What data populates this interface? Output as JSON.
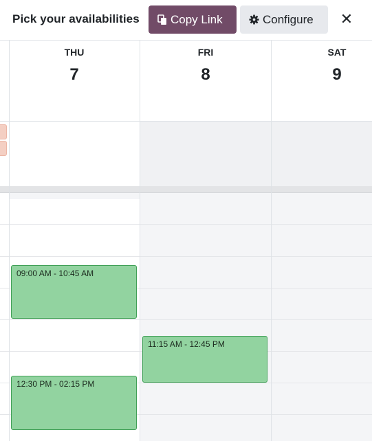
{
  "header": {
    "title": "Pick your availabilities",
    "copy_link_label": "Copy Link",
    "configure_label": "Configure",
    "close_glyph": "✕",
    "primary_color": "#714b67"
  },
  "days": [
    {
      "name": "THU",
      "number": "7"
    },
    {
      "name": "FRI",
      "number": "8"
    },
    {
      "name": "SAT",
      "number": "9"
    }
  ],
  "events": [
    {
      "day": "THU",
      "label": "09:00 AM - 10:45 AM"
    },
    {
      "day": "THU",
      "label": "12:30 PM - 02:15 PM"
    },
    {
      "day": "FRI",
      "label": "11:15 AM - 12:45 PM"
    }
  ],
  "colors": {
    "event_fill": "#92d3a0",
    "event_border": "#3f9f55",
    "past_event_peek": "#f4cfc3"
  }
}
